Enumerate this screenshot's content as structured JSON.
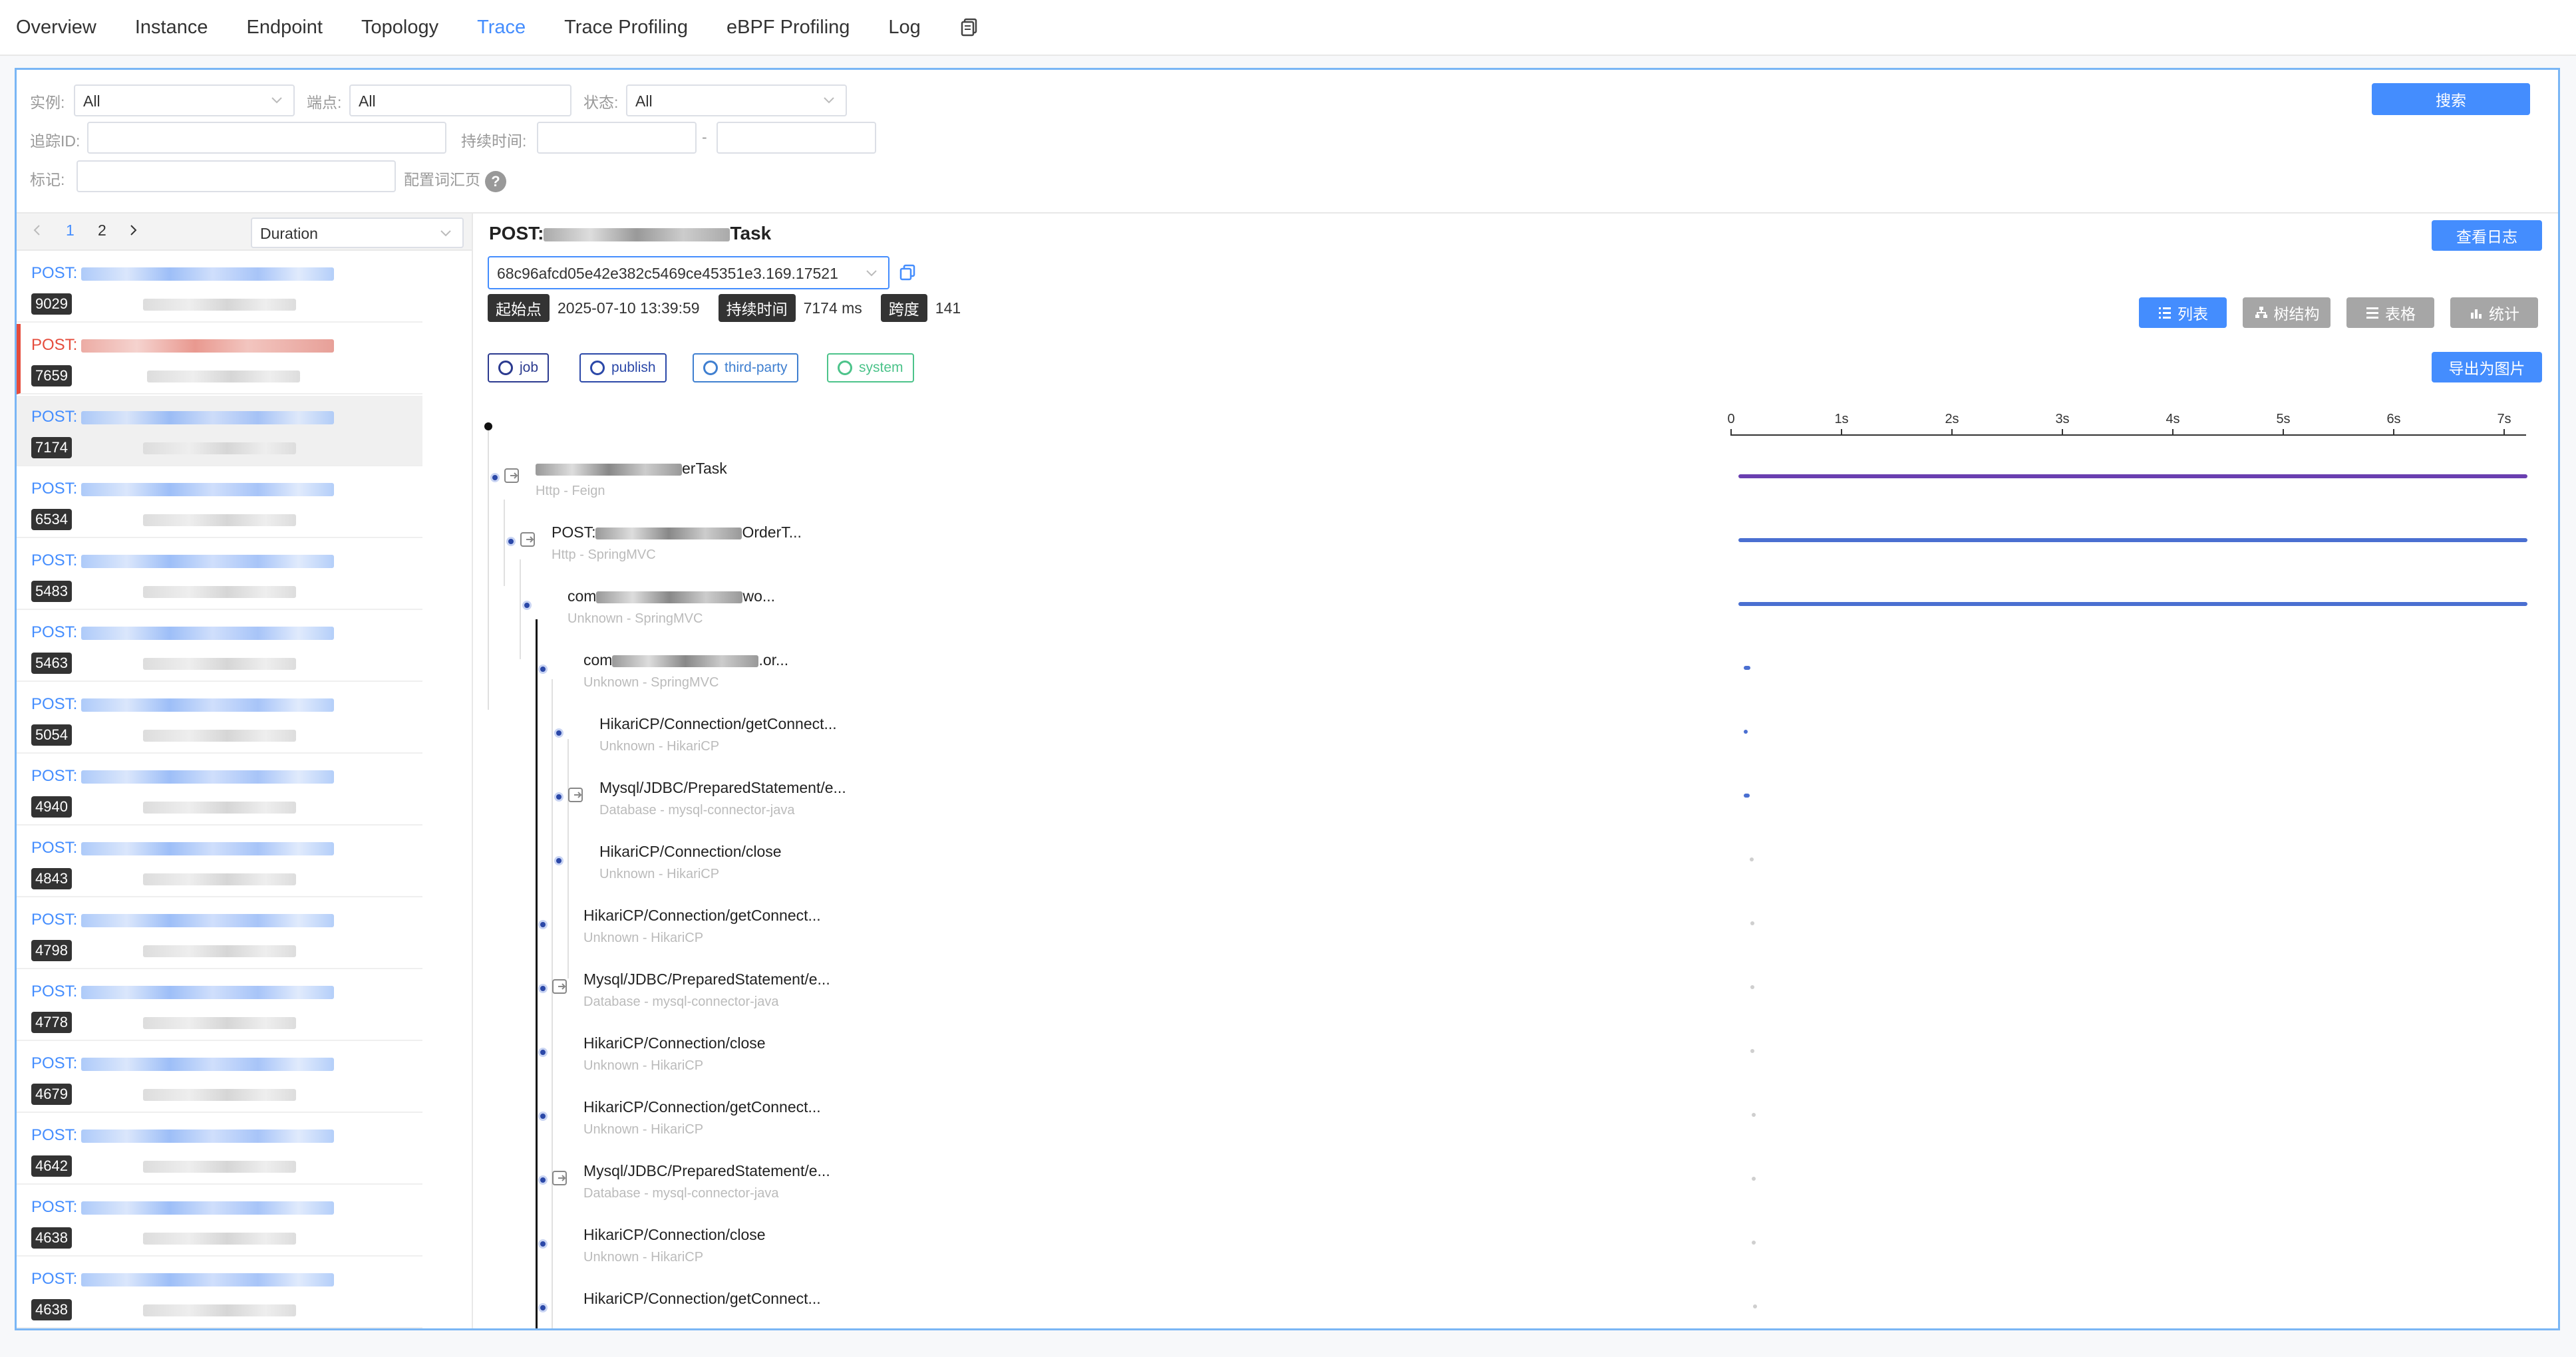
{
  "nav": {
    "tabs": [
      {
        "label": "Overview",
        "active": false
      },
      {
        "label": "Instance",
        "active": false
      },
      {
        "label": "Endpoint",
        "active": false
      },
      {
        "label": "Topology",
        "active": false
      },
      {
        "label": "Trace",
        "active": true
      },
      {
        "label": "Trace Profiling",
        "active": false
      },
      {
        "label": "eBPF Profiling",
        "active": false
      },
      {
        "label": "Log",
        "active": false
      }
    ],
    "copy_icon": "copy-icon"
  },
  "filters": {
    "instance_label": "实例:",
    "instance_value": "All",
    "endpoint_label": "端点:",
    "endpoint_value": "All",
    "status_label": "状态:",
    "status_value": "All",
    "traceid_label": "追踪ID:",
    "traceid_value": "",
    "duration_label": "持续时间:",
    "duration_from": "",
    "duration_sep": "-",
    "duration_to": "",
    "tags_label": "标记:",
    "tags_value": "",
    "config_label": "配置词汇页",
    "help_icon": "?",
    "search_button": "搜索"
  },
  "trace_list": {
    "pages": [
      "1",
      "2"
    ],
    "current_page": "1",
    "sort_value": "Duration",
    "items": [
      {
        "endpoint_prefix": "POST:",
        "duration": "9029",
        "error": false,
        "selected": false
      },
      {
        "endpoint_prefix": "POST:",
        "duration": "7659",
        "error": true,
        "selected": false
      },
      {
        "endpoint_prefix": "POST:",
        "duration": "7174",
        "error": false,
        "selected": true
      },
      {
        "endpoint_prefix": "POST:",
        "duration": "6534",
        "error": false,
        "selected": false
      },
      {
        "endpoint_prefix": "POST:",
        "duration": "5483",
        "error": false,
        "selected": false
      },
      {
        "endpoint_prefix": "POST:",
        "duration": "5463",
        "error": false,
        "selected": false
      },
      {
        "endpoint_prefix": "POST:",
        "duration": "5054",
        "error": false,
        "selected": false
      },
      {
        "endpoint_prefix": "POST:",
        "duration": "4940",
        "error": false,
        "selected": false
      },
      {
        "endpoint_prefix": "POST:",
        "duration": "4843",
        "error": false,
        "selected": false
      },
      {
        "endpoint_prefix": "POST:",
        "duration": "4798",
        "error": false,
        "selected": false
      },
      {
        "endpoint_prefix": "POST:",
        "duration": "4778",
        "error": false,
        "selected": false
      },
      {
        "endpoint_prefix": "POST:",
        "duration": "4679",
        "error": false,
        "selected": false
      },
      {
        "endpoint_prefix": "POST:",
        "duration": "4642",
        "error": false,
        "selected": false
      },
      {
        "endpoint_prefix": "POST:",
        "duration": "4638",
        "error": false,
        "selected": false
      },
      {
        "endpoint_prefix": "POST:",
        "duration": "4638",
        "error": false,
        "selected": false
      }
    ]
  },
  "detail": {
    "title_prefix": "POST:",
    "title_suffix": "Task",
    "view_log_button": "查看日志",
    "trace_id": "68c96afcd05e42e382c5469ce45351e3.169.17521",
    "start_label": "起始点",
    "start_value": "2025-07-10 13:39:59",
    "duration_label": "持续时间",
    "duration_value": "7174 ms",
    "span_label": "跨度",
    "span_value": "141",
    "views": [
      {
        "label": "列表",
        "icon": "list-icon",
        "active": true
      },
      {
        "label": "树结构",
        "icon": "tree-icon",
        "active": false
      },
      {
        "label": "表格",
        "icon": "table-icon",
        "active": false
      },
      {
        "label": "统计",
        "icon": "stats-icon",
        "active": false
      }
    ],
    "export_button": "导出为图片",
    "legend": [
      {
        "label": "job",
        "color": "#2b3a8f"
      },
      {
        "label": "publish",
        "color": "#2b48a8"
      },
      {
        "label": "third-party",
        "color": "#3f7fd0"
      },
      {
        "label": "system",
        "color": "#4cc38a"
      }
    ],
    "axis_ticks": [
      "0",
      "1s",
      "2s",
      "3s",
      "4s",
      "5s",
      "6s",
      "7s"
    ],
    "spans": [
      {
        "name_prefix": "",
        "name_suffix": "erTask",
        "sub": "Http - Feign",
        "depth": 1,
        "exit": true,
        "bar_color": "#6a3fb0",
        "start": 0.0,
        "dur": 7.17
      },
      {
        "name_prefix": "POST:",
        "name_suffix": "OrderT...",
        "sub": "Http - SpringMVC",
        "depth": 2,
        "exit": true,
        "bar_color": "#4a6fd1",
        "start": 0.0,
        "dur": 7.17
      },
      {
        "name_prefix": "com",
        "name_suffix": "wo...",
        "sub": "Unknown - SpringMVC",
        "depth": 3,
        "exit": false,
        "bar_color": "#4a6fd1",
        "start": 0.0,
        "dur": 7.17
      },
      {
        "name_prefix": "com",
        "name_suffix": ".or...",
        "sub": "Unknown - SpringMVC",
        "depth": 4,
        "exit": false,
        "bar_color": "#4a6fd1",
        "start": 0.05,
        "dur": 0.06
      },
      {
        "name_prefix": "HikariCP/Connection/getConnect...",
        "name_suffix": "",
        "sub": "Unknown - HikariCP",
        "depth": 5,
        "exit": false,
        "bar_color": "#4a6fd1",
        "start": 0.05,
        "dur": 0.01
      },
      {
        "name_prefix": "Mysql/JDBC/PreparedStatement/e...",
        "name_suffix": "",
        "sub": "Database - mysql-connector-java",
        "depth": 5,
        "exit": true,
        "bar_color": "#4a6fd1",
        "start": 0.05,
        "dur": 0.05
      },
      {
        "name_prefix": "HikariCP/Connection/close",
        "name_suffix": "",
        "sub": "Unknown - HikariCP",
        "depth": 5,
        "exit": false,
        "bar_color": "#cfcfcf",
        "start": 0.1,
        "dur": 0.01
      },
      {
        "name_prefix": "HikariCP/Connection/getConnect...",
        "name_suffix": "",
        "sub": "Unknown - HikariCP",
        "depth": 4,
        "exit": false,
        "bar_color": "#cfcfcf",
        "start": 0.11,
        "dur": 0.01
      },
      {
        "name_prefix": "Mysql/JDBC/PreparedStatement/e...",
        "name_suffix": "",
        "sub": "Database - mysql-connector-java",
        "depth": 4,
        "exit": true,
        "bar_color": "#cfcfcf",
        "start": 0.11,
        "dur": 0.01
      },
      {
        "name_prefix": "HikariCP/Connection/close",
        "name_suffix": "",
        "sub": "Unknown - HikariCP",
        "depth": 4,
        "exit": false,
        "bar_color": "#cfcfcf",
        "start": 0.11,
        "dur": 0.01
      },
      {
        "name_prefix": "HikariCP/Connection/getConnect...",
        "name_suffix": "",
        "sub": "Unknown - HikariCP",
        "depth": 4,
        "exit": false,
        "bar_color": "#cfcfcf",
        "start": 0.12,
        "dur": 0.01
      },
      {
        "name_prefix": "Mysql/JDBC/PreparedStatement/e...",
        "name_suffix": "",
        "sub": "Database - mysql-connector-java",
        "depth": 4,
        "exit": true,
        "bar_color": "#cfcfcf",
        "start": 0.12,
        "dur": 0.01
      },
      {
        "name_prefix": "HikariCP/Connection/close",
        "name_suffix": "",
        "sub": "Unknown - HikariCP",
        "depth": 4,
        "exit": false,
        "bar_color": "#cfcfcf",
        "start": 0.12,
        "dur": 0.01
      },
      {
        "name_prefix": "HikariCP/Connection/getConnect...",
        "name_suffix": "",
        "sub": "",
        "depth": 4,
        "exit": false,
        "bar_color": "#cfcfcf",
        "start": 0.13,
        "dur": 0.01
      }
    ]
  }
}
